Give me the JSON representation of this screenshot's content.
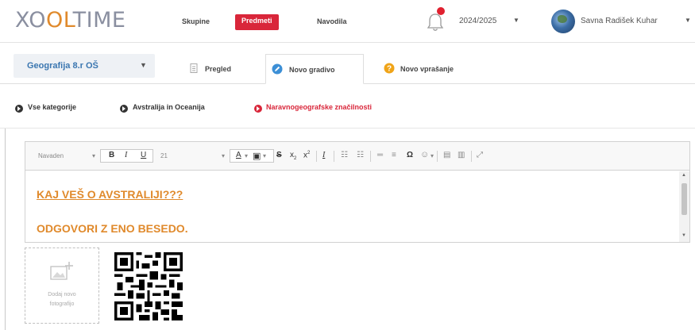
{
  "app": {
    "logo": {
      "part1": "XO",
      "part2": "OL",
      "part3": "TIME"
    }
  },
  "nav": {
    "items": [
      "Skupine",
      "Predmeti",
      "Navodila"
    ],
    "active": "Predmeti",
    "school_year": "2024/2025",
    "user_name": "Savna Radišek Kuhar",
    "notification_icon": "bell-icon",
    "colors": {
      "active": "#d9263a",
      "brand_orange": "#e08a2c",
      "brand_gray": "#8a8fa0"
    }
  },
  "subject": {
    "label": "Geografija 8.r OŠ"
  },
  "tabs": [
    {
      "label": "Pregled",
      "icon": "document-icon",
      "active": false
    },
    {
      "label": "Novo gradivo",
      "icon": "pencil-circle-icon",
      "active": true
    },
    {
      "label": "Novo vprašanje",
      "icon": "question-circle-icon",
      "active": false
    }
  ],
  "breadcrumb": [
    {
      "label": "Vse kategorije",
      "current": false
    },
    {
      "label": "Avstralija in Oceanija",
      "current": false
    },
    {
      "label": "Naravnogeografske značilnosti",
      "current": true
    }
  ],
  "editor": {
    "toolbar": {
      "format_select": "Navaden",
      "font_size": "21",
      "bold": "B",
      "italic": "I",
      "underline": "U",
      "text_color": "A",
      "strike": "S",
      "subscript": "x",
      "superscript": "x",
      "clear_format": "I",
      "omega": "Ω",
      "icons": [
        "bold-icon",
        "italic-icon",
        "underline-icon",
        "text-color-icon",
        "background-color-icon",
        "strikethrough-icon",
        "subscript-icon",
        "superscript-icon",
        "remove-format-icon",
        "numbered-list-icon",
        "bulleted-list-icon",
        "horizontal-line-icon",
        "indent-icon",
        "special-character-icon",
        "emoji-icon",
        "paste-icon",
        "paste-text-icon",
        "maximize-icon"
      ]
    },
    "content": {
      "line1": "KAJ VEŠ O AVSTRALIJI???",
      "line2": "ODGOVORI Z ENO BESEDO."
    }
  },
  "upload": {
    "label": "Dodaj novo fotografijo",
    "icon": "add-image-icon"
  },
  "qr": {
    "icon": "qr-code-icon"
  }
}
